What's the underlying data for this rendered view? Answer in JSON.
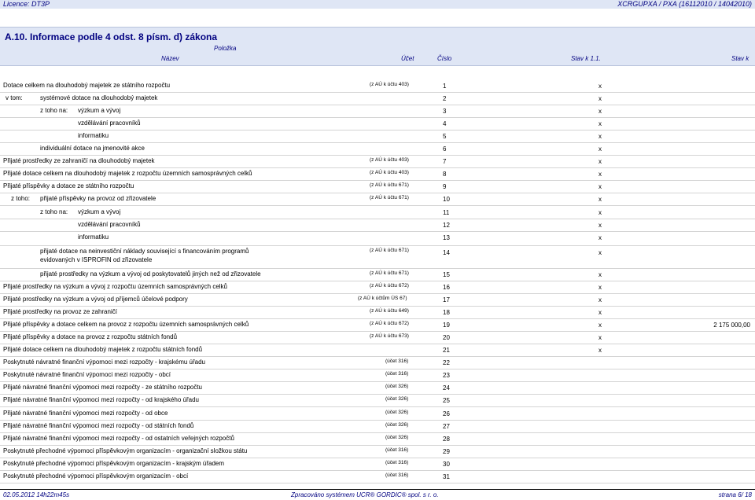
{
  "header": {
    "licence": "Licence: DT3P",
    "report_code": "XCRGUPXA / PXA  (16112010 / 14042010)"
  },
  "section": {
    "title": "A.10.   Informace podle 4 odst. 8 písm. d) zákona",
    "col_polozka": "Položka",
    "col_nazev": "Název",
    "col_ucet": "Účet",
    "col_cislo": "Číslo",
    "col_stav_k1": "Stav k 1.1.",
    "col_stav_k": "Stav k"
  },
  "rows": [
    {
      "prefix": "",
      "text": "Dotace celkem na dlouhodobý majetek ze státního rozpočtu",
      "ref": "(z AÚ k účtu 403)",
      "num": "1",
      "val": "x",
      "val2": ""
    },
    {
      "prefix": "v tom:",
      "text": "systémové dotace na dlouhodobý majetek",
      "ref": "",
      "num": "2",
      "val": "x",
      "val2": ""
    },
    {
      "prefix": "z toho na:",
      "text": "výzkum a vývoj",
      "ref": "",
      "num": "3",
      "val": "x",
      "val2": ""
    },
    {
      "prefix": "",
      "text": "vzdělávání pracovníků",
      "ref": "",
      "num": "4",
      "val": "x",
      "val2": ""
    },
    {
      "prefix": "",
      "text": "informatiku",
      "ref": "",
      "num": "5",
      "val": "x",
      "val2": ""
    },
    {
      "prefix": "",
      "text": "individuální dotace na jmenovité akce",
      "ref": "",
      "num": "6",
      "val": "x",
      "val2": ""
    },
    {
      "prefix": "",
      "text": "Přijaté prostředky ze zahraničí na dlouhodobý majetek",
      "ref": "(z AÚ k účtu 403)",
      "num": "7",
      "val": "x",
      "val2": ""
    },
    {
      "prefix": "",
      "text": "Přijaté dotace celkem na dlouhodobý majetek z rozpočtu územních samosprávných celků",
      "ref": "(z AÚ k účtu 403)",
      "num": "8",
      "val": "x",
      "val2": ""
    },
    {
      "prefix": "",
      "text": "Přijaté příspěvky a dotace ze státního rozpočtu",
      "ref": "(z AÚ k účtu 671)",
      "num": "9",
      "val": "x",
      "val2": ""
    },
    {
      "prefix": "z toho:",
      "text": "přijaté příspěvky na provoz od zřizovatele",
      "ref": "(z AÚ k účtu 671)",
      "num": "10",
      "val": "x",
      "val2": ""
    },
    {
      "prefix": "z toho na:",
      "text": "výzkum a vývoj",
      "ref": "",
      "num": "11",
      "val": "x",
      "val2": ""
    },
    {
      "prefix": "",
      "text": "vzdělávání pracovníků",
      "ref": "",
      "num": "12",
      "val": "x",
      "val2": ""
    },
    {
      "prefix": "",
      "text": "informatiku",
      "ref": "",
      "num": "13",
      "val": "x",
      "val2": ""
    },
    {
      "prefix": "",
      "text": "přijaté dotace na neinvestiční náklady související s financováním programů",
      "text2": "evidovaných v ISPROFIN od zřizovatele",
      "ref": "(z AÚ k účtu 671)",
      "num": "14",
      "val": "x",
      "val2": ""
    },
    {
      "prefix": "",
      "text": "přijaté prostředky na výzkum a vývoj od poskytovatelů jiných než od zřizovatele",
      "ref": "(z AÚ k účtu 671)",
      "num": "15",
      "val": "x",
      "val2": ""
    },
    {
      "prefix": "",
      "text": "Přijaté prostředky na výzkum a vývoj z rozpočtu územních samosprávných celků",
      "ref": "(z AÚ k účtu 672)",
      "num": "16",
      "val": "x",
      "val2": ""
    },
    {
      "prefix": "",
      "text": "Přijaté prostředky na výzkum a vývoj od příjemců účelové podpory",
      "ref": "(z AÚ k účtům ÚS 67)",
      "num": "17",
      "val": "x",
      "val2": ""
    },
    {
      "prefix": "",
      "text": "Přijaté prostředky na provoz ze zahraničí",
      "ref": "(z AÚ k účtu 649)",
      "num": "18",
      "val": "x",
      "val2": ""
    },
    {
      "prefix": "",
      "text": "Přijaté příspěvky a dotace celkem na provoz z rozpočtu územních samosprávných celků",
      "ref": "(z AÚ k účtu 672)",
      "num": "19",
      "val": "x",
      "val2": "2 175 000,00"
    },
    {
      "prefix": "",
      "text": "Přijaté příspěvky a dotace na provoz z rozpočtu státních fondů",
      "ref": "(z AÚ k účtu 673)",
      "num": "20",
      "val": "x",
      "val2": ""
    },
    {
      "prefix": "",
      "text": "Přijaté dotace celkem na dlouhodobý majetek z rozpočtu státních fondů",
      "ref": "",
      "num": "21",
      "val": "x",
      "val2": ""
    },
    {
      "prefix": "",
      "text": "Poskytnuté návratné finanční výpomoci mezi rozpočty - krajskému úřadu",
      "ref": "(účet 316)",
      "num": "22",
      "val": "",
      "val2": ""
    },
    {
      "prefix": "",
      "text": "Poskytnuté návratné finanční výpomoci mezi rozpočty - obcí",
      "ref": "(účet 316)",
      "num": "23",
      "val": "",
      "val2": ""
    },
    {
      "prefix": "",
      "text": "Přijaté návratné finanční výpomoci mezi rozpočty - ze státního rozpočtu",
      "ref": "(účet 326)",
      "num": "24",
      "val": "",
      "val2": ""
    },
    {
      "prefix": "",
      "text": "Přijaté návratné finanční výpomoci mezi rozpočty - od krajského úřadu",
      "ref": "(účet 326)",
      "num": "25",
      "val": "",
      "val2": ""
    },
    {
      "prefix": "",
      "text": "Přijaté návratné finanční výpomoci mezi rozpočty - od obce",
      "ref": "(účet 326)",
      "num": "26",
      "val": "",
      "val2": ""
    },
    {
      "prefix": "",
      "text": "Přijaté návratné finanční výpomoci mezi rozpočty - od státních fondů",
      "ref": "(účet 326)",
      "num": "27",
      "val": "",
      "val2": ""
    },
    {
      "prefix": "",
      "text": "Přijaté návratné finanční výpomoci mezi rozpočty - od ostatních veřejných rozpočtů",
      "ref": "(účet 326)",
      "num": "28",
      "val": "",
      "val2": ""
    },
    {
      "prefix": "",
      "text": "Poskytnuté přechodné výpomoci příspěvkovým organizacím - organizační složkou státu",
      "ref": "(účet 316)",
      "num": "29",
      "val": "",
      "val2": ""
    },
    {
      "prefix": "",
      "text": "Poskytnuté přechodné výpomoci příspěvkovým organizacím - krajským úřadem",
      "ref": "(účet 316)",
      "num": "30",
      "val": "",
      "val2": ""
    },
    {
      "prefix": "",
      "text": "Poskytnuté přechodné výpomoci příspěvkovým organizacím - obcí",
      "ref": "(účet 316)",
      "num": "31",
      "val": "",
      "val2": ""
    }
  ],
  "footer": {
    "datetime": "02.05.2012 14h22m45s",
    "processed": "Zpracováno systémem   UCR® GORDIC® spol. s  r. o.",
    "page": "strana  6/ 18"
  }
}
